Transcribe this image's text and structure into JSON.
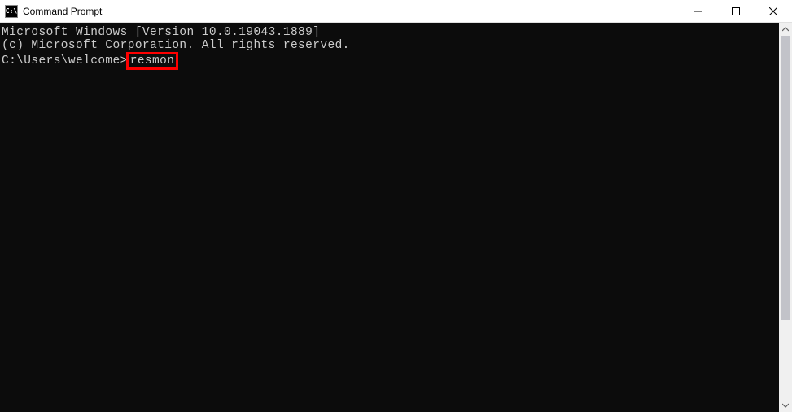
{
  "window": {
    "title": "Command Prompt",
    "icon_label": "C:\\"
  },
  "terminal": {
    "line1": "Microsoft Windows [Version 10.0.19043.1889]",
    "line2": "(c) Microsoft Corporation. All rights reserved.",
    "blank": "",
    "prompt": "C:\\Users\\welcome>",
    "command": "resmon"
  }
}
